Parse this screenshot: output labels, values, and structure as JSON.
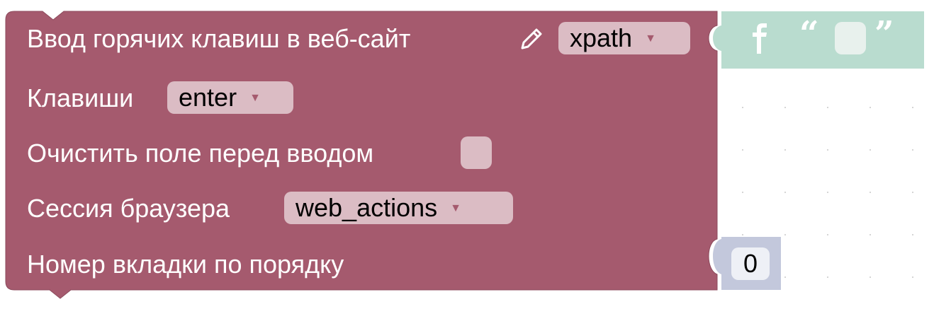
{
  "block": {
    "title": "Ввод горячих клавиш в веб-сайт",
    "selector_mode": "xpath",
    "keys_label": "Клавиши",
    "keys_value": "enter",
    "clear_label": "Очистить поле перед вводом",
    "clear_checked": false,
    "session_label": "Сессия браузера",
    "session_value": "web_actions",
    "tab_label": "Номер вкладки по порядку",
    "color": "#a55a6e",
    "field_color": "#dbbcc4"
  },
  "text_block": {
    "icon": "f-icon",
    "open_quote": "“",
    "close_quote": "”",
    "value": "",
    "color": "#b9dccf"
  },
  "number_block": {
    "value": "0",
    "color": "#c3c8dc"
  },
  "icons": {
    "edit": "pencil-icon",
    "dropdown": "triangle-down-icon"
  }
}
